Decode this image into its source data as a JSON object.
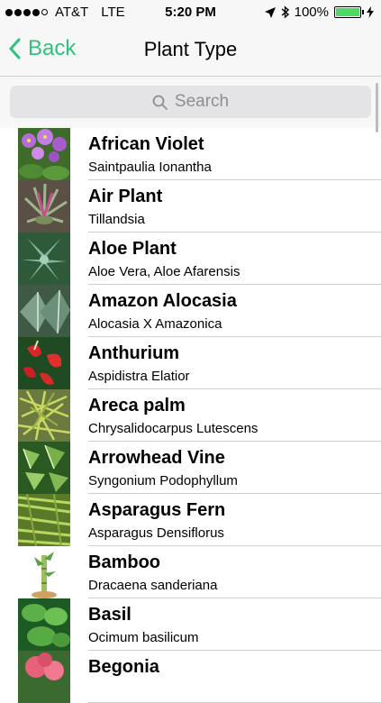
{
  "status_bar": {
    "carrier": "AT&T",
    "network": "LTE",
    "time": "5:20 PM",
    "battery": "100%",
    "signal_bars": 4,
    "battery_color": "#4cd964"
  },
  "nav": {
    "back_label": "Back",
    "title": "Plant Type",
    "accent_color": "#2ec27e"
  },
  "search": {
    "placeholder": "Search"
  },
  "plants": [
    {
      "name": "African Violet",
      "scientific": "Saintpaulia Ionantha"
    },
    {
      "name": "Air Plant",
      "scientific": "Tillandsia"
    },
    {
      "name": "Aloe Plant",
      "scientific": "Aloe Vera, Aloe Afarensis"
    },
    {
      "name": "Amazon Alocasia",
      "scientific": "Alocasia X Amazonica"
    },
    {
      "name": "Anthurium",
      "scientific": "Aspidistra Elatior"
    },
    {
      "name": "Areca palm",
      "scientific": "Chrysalidocarpus Lutescens"
    },
    {
      "name": "Arrowhead Vine",
      "scientific": "Syngonium Podophyllum"
    },
    {
      "name": "Asparagus Fern",
      "scientific": "Asparagus Densiflorus"
    },
    {
      "name": "Bamboo",
      "scientific": "Dracaena sanderiana"
    },
    {
      "name": "Basil",
      "scientific": "Ocimum basilicum"
    },
    {
      "name": "Begonia",
      "scientific": ""
    }
  ]
}
